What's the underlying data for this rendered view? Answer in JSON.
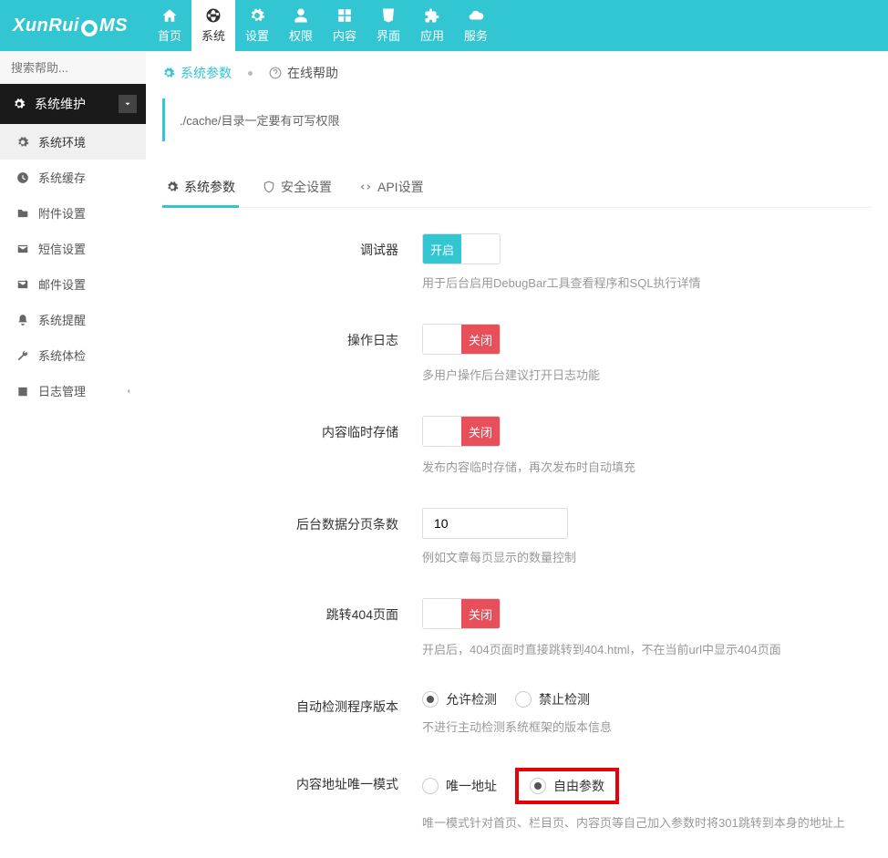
{
  "brand": {
    "left": "XunRui",
    "right": "MS"
  },
  "topnav": [
    {
      "label": "首页"
    },
    {
      "label": "系统"
    },
    {
      "label": "设置"
    },
    {
      "label": "权限"
    },
    {
      "label": "内容"
    },
    {
      "label": "界面"
    },
    {
      "label": "应用"
    },
    {
      "label": "服务"
    }
  ],
  "sidebar": {
    "search_placeholder": "搜索帮助...",
    "category": "系统维护",
    "items": [
      {
        "label": "系统环境"
      },
      {
        "label": "系统缓存"
      },
      {
        "label": "附件设置"
      },
      {
        "label": "短信设置"
      },
      {
        "label": "邮件设置"
      },
      {
        "label": "系统提醒"
      },
      {
        "label": "系统体检"
      },
      {
        "label": "日志管理"
      }
    ]
  },
  "crumbs": {
    "a": "系统参数",
    "b": "在线帮助"
  },
  "alert": "./cache/目录一定要有可写权限",
  "tabs": [
    {
      "label": "系统参数"
    },
    {
      "label": "安全设置"
    },
    {
      "label": "API设置"
    }
  ],
  "toggle_text": {
    "on": "开启",
    "off": "关闭"
  },
  "fields": {
    "debugger": {
      "label": "调试器",
      "value": "on",
      "help": "用于后台启用DebugBar工具查看程序和SQL执行详情"
    },
    "oplog": {
      "label": "操作日志",
      "value": "off",
      "help": "多用户操作后台建议打开日志功能"
    },
    "tmpstore": {
      "label": "内容临时存储",
      "value": "off",
      "help": "发布内容临时存储，再次发布时自动填充"
    },
    "pagesize": {
      "label": "后台数据分页条数",
      "value": "10",
      "help": "例如文章每页显示的数量控制"
    },
    "jump404": {
      "label": "跳转404页面",
      "value": "off",
      "help": "开启后，404页面时直接跳转到404.html，不在当前url中显示404页面"
    },
    "autocheck": {
      "label": "自动检测程序版本",
      "options": [
        "允许检测",
        "禁止检测"
      ],
      "checked": 0,
      "help": "不进行主动检测系统框架的版本信息"
    },
    "urlmode": {
      "label": "内容地址唯一模式",
      "options": [
        "唯一地址",
        "自由参数"
      ],
      "checked": 1,
      "help": "唯一模式针对首页、栏目页、内容页等自己加入参数时将301跳转到本身的地址上"
    }
  }
}
